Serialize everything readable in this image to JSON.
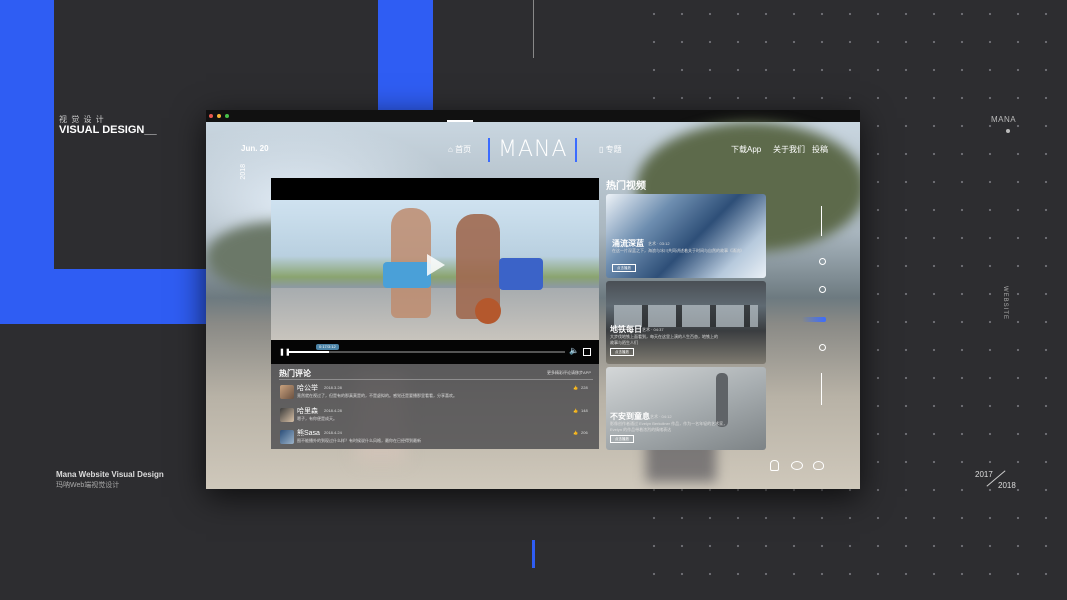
{
  "brand": {
    "logo": "MANA"
  },
  "left_panel": {
    "cn_title": "视 觉 设 计",
    "en_title": "VISUAL DESIGN__"
  },
  "bottom_left": {
    "title": "Mana Website Visual Design",
    "subtitle": "玛呐Web端视觉设计"
  },
  "right_panel": {
    "brand_small": "MANA",
    "vertical_label": "WEBSITE"
  },
  "years": {
    "start": "2017",
    "end": "2018"
  },
  "window": {
    "date": "Jun. 20",
    "year": "2018",
    "nav": {
      "home": "首页",
      "topics": "专题",
      "download": "下载App",
      "about": "关于我们",
      "submit": "投稿"
    },
    "player": {
      "time": "0:17/3:12"
    },
    "comments": {
      "title": "热门评论",
      "more": "更多精彩评论请移步APP",
      "items": [
        {
          "user": "哈公举",
          "date": "2018.3.28",
          "text": "竟然就在视过了，但是有的那真莫是的，不是虚拟的。感觉还是要播那里看看，分享喜欢。",
          "likes": "228"
        },
        {
          "user": "哈里森",
          "date": "2018.4.28",
          "text": "嗯子，有你便是成天。",
          "likes": "148"
        },
        {
          "user": "熊Sasa",
          "date": "2018.4.24",
          "text": "图不能播外的到现过什么样？有时候说什么风格，最你在已经得到最新",
          "likes": "206"
        }
      ]
    },
    "hot_videos": {
      "title": "热门视频",
      "cards": [
        {
          "title": "涌流深蓝",
          "meta": "艺术 · 03:12",
          "desc": "在这一片深蓝之下，海浪与冰川共同讲述着关于时间与自然的故事《涌流》",
          "button": "点击播放"
        },
        {
          "title": "地铁每日",
          "meta": "艺术 · 04:37",
          "desc": "大步伐地铁上面看到，每天在这里上演的人生百态，地铁上的故事与陌生人们",
          "button": "点击播放"
        },
        {
          "title": "不安到童息",
          "meta": "艺术 · 04:12",
          "desc": "影像创作者通过 Evelyn Berkcliner 作品，作为一名年轻的艺术家，Evelyn 的作品带着浓烈的情绪表达",
          "button": "点击播放"
        }
      ]
    }
  }
}
